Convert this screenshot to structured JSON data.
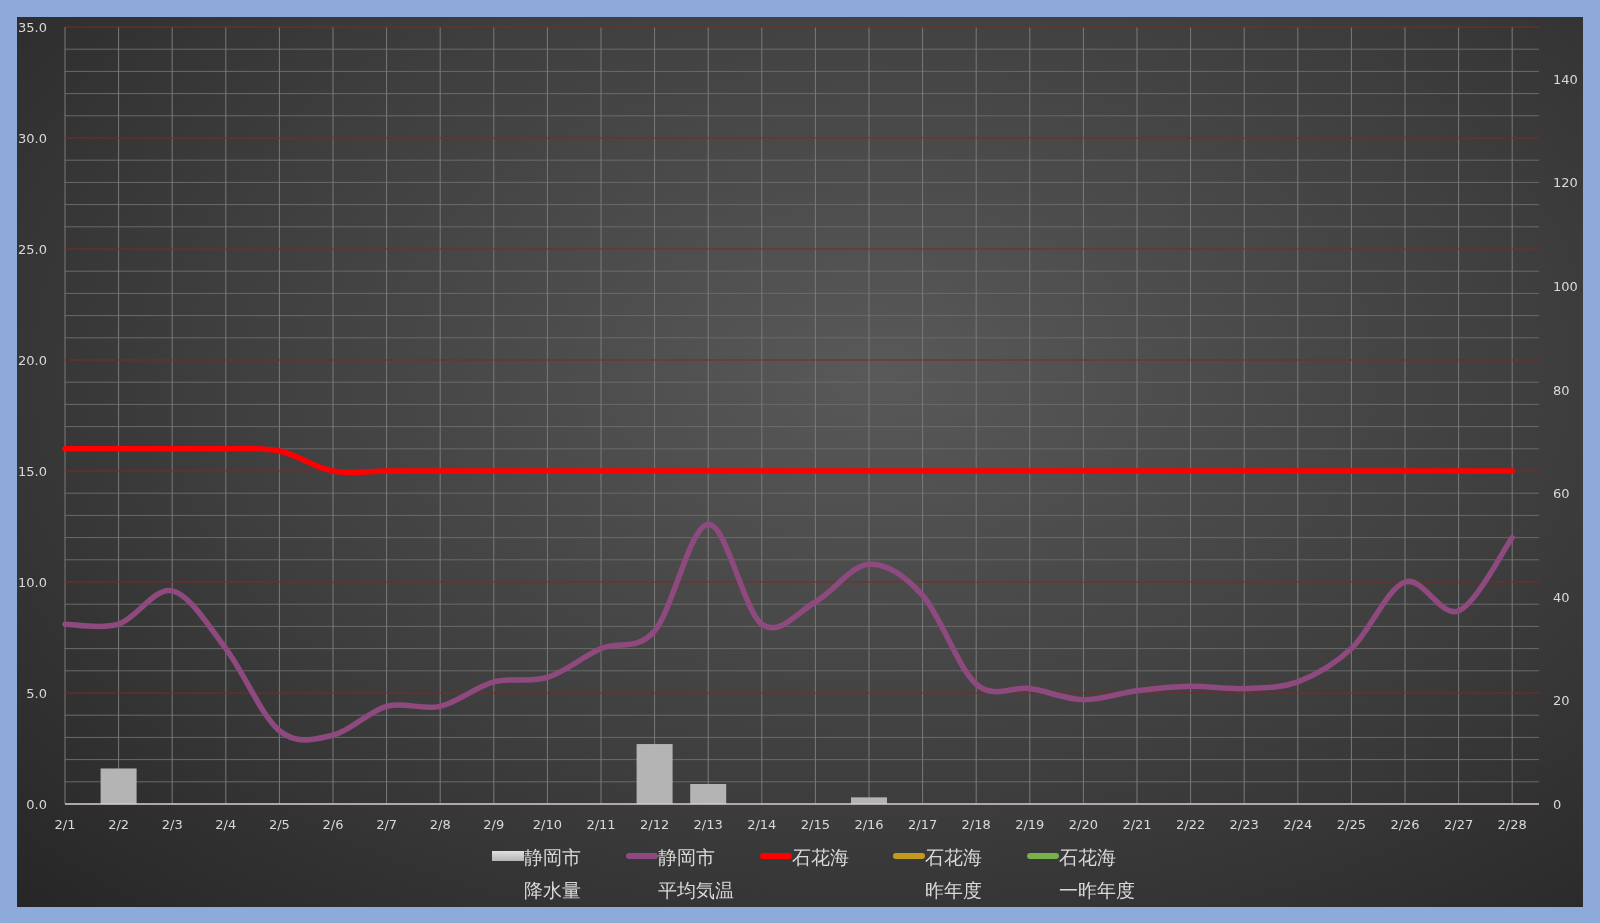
{
  "chart_data": {
    "type": "line",
    "categories": [
      "2/1",
      "2/2",
      "2/3",
      "2/4",
      "2/5",
      "2/6",
      "2/7",
      "2/8",
      "2/9",
      "2/10",
      "2/11",
      "2/12",
      "2/13",
      "2/14",
      "2/15",
      "2/16",
      "2/17",
      "2/18",
      "2/19",
      "2/20",
      "2/21",
      "2/22",
      "2/23",
      "2/24",
      "2/25",
      "2/26",
      "2/27",
      "2/28"
    ],
    "ylim": [
      0,
      35
    ],
    "grid": true,
    "yticks": [
      {
        "value": 0,
        "label": "0.0"
      },
      {
        "value": 5,
        "label": "5.0"
      },
      {
        "value": 10,
        "label": "10.0"
      },
      {
        "value": 15,
        "label": "15.0"
      },
      {
        "value": 20,
        "label": "20.0"
      },
      {
        "value": 25,
        "label": "25.0"
      },
      {
        "value": 30,
        "label": "30.0"
      },
      {
        "value": 35,
        "label": "35.0"
      }
    ],
    "series": [
      {
        "name": "静岡市降水量",
        "type": "bar",
        "color": "#b4b4b4",
        "values": [
          0,
          1.6,
          0,
          0,
          0,
          0,
          0,
          0,
          0,
          0,
          0,
          2.7,
          0.9,
          0,
          0,
          0.3,
          0,
          0,
          0,
          0,
          0,
          0,
          0,
          0,
          0,
          0,
          0,
          0
        ]
      },
      {
        "name": "静岡市平均気温",
        "type": "line",
        "color": "#8e4a7e",
        "values": [
          8.1,
          8.1,
          9.6,
          7.0,
          3.3,
          3.1,
          4.4,
          4.4,
          5.5,
          5.7,
          7.0,
          7.8,
          12.6,
          8.1,
          9.1,
          10.8,
          9.4,
          5.4,
          5.2,
          4.7,
          5.1,
          5.3,
          5.2,
          5.5,
          7.0,
          10.0,
          8.7,
          12.0
        ]
      },
      {
        "name": "石花海",
        "type": "line",
        "color": "#ff0000",
        "values": [
          16.0,
          16.0,
          16.0,
          16.0,
          15.9,
          15.0,
          15.0,
          15.0,
          15.0,
          15.0,
          15.0,
          15.0,
          15.0,
          15.0,
          15.0,
          15.0,
          15.0,
          15.0,
          15.0,
          15.0,
          15.0,
          15.0,
          15.0,
          15.0,
          15.0,
          15.0,
          15.0,
          15.0
        ]
      },
      {
        "name": "石花海昨年度",
        "type": "line",
        "color": "#c49a1e",
        "values": [
          null,
          null,
          null,
          null,
          null,
          null,
          null,
          null,
          null,
          null,
          null,
          null,
          null,
          null,
          null,
          null,
          null,
          null,
          null,
          null,
          null,
          null,
          null,
          null,
          null,
          null,
          null,
          null
        ]
      },
      {
        "name": "石花海一昨年度",
        "type": "line",
        "color": "#78b04a",
        "values": [
          null,
          null,
          null,
          null,
          null,
          null,
          null,
          null,
          null,
          null,
          null,
          null,
          null,
          null,
          null,
          null,
          null,
          null,
          null,
          null,
          null,
          null,
          null,
          null,
          null,
          null,
          null,
          null
        ]
      }
    ]
  },
  "secondary_axis_ticks": [
    "140",
    "120",
    "100",
    "80",
    "60",
    "40",
    "20",
    "0"
  ]
}
